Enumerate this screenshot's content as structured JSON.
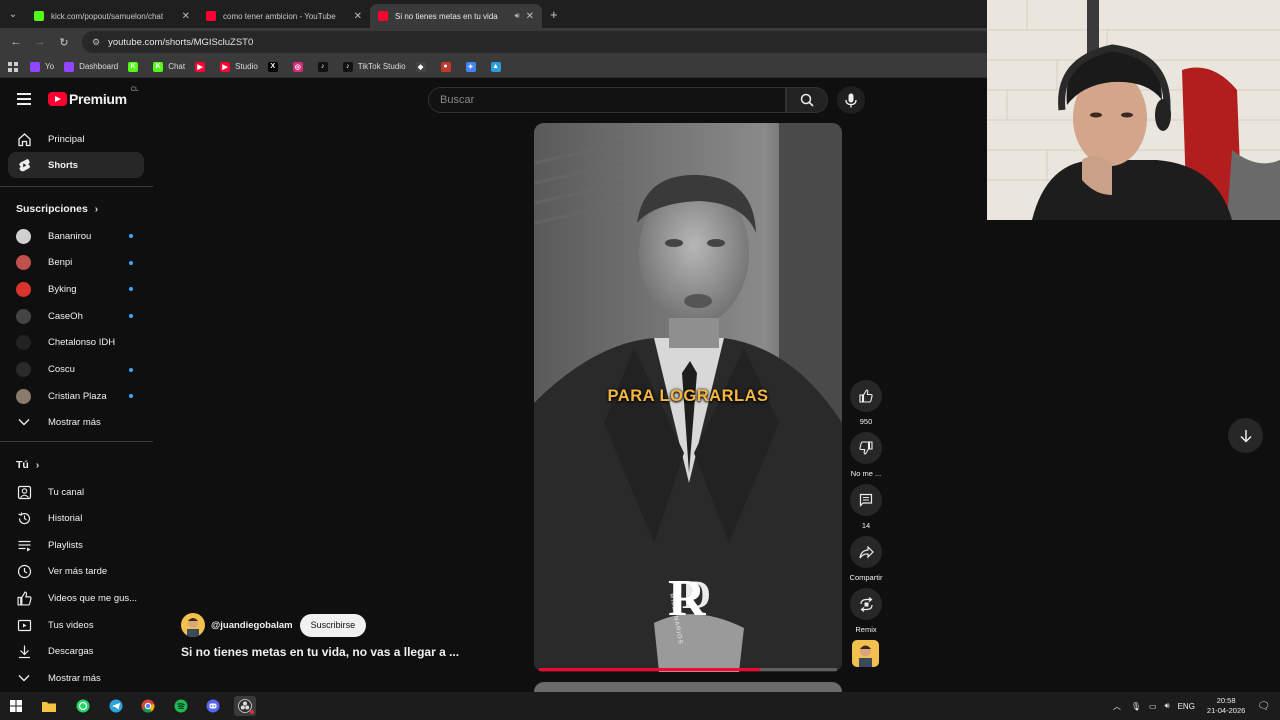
{
  "browser": {
    "tabs": [
      {
        "title": "kick.com/popout/samuelon/chat",
        "favicon_color": "#53fc18",
        "active": false
      },
      {
        "title": "como tener ambicion - YouTube",
        "favicon_color": "#ff0033",
        "active": false
      },
      {
        "title": "Si no tienes metas en tu vida",
        "favicon_color": "#ff0033",
        "active": true
      }
    ],
    "address": "youtube.com/shorts/MGIScluZST0",
    "bookmarks": [
      {
        "label": "Yo",
        "icon": "twitch-icon",
        "color": "#9146ff",
        "glyph": ""
      },
      {
        "label": "Dashboard",
        "icon": "twitch-icon",
        "color": "#9146ff",
        "glyph": ""
      },
      {
        "label": "",
        "icon": "kick-icon",
        "color": "#53fc18",
        "glyph": "K"
      },
      {
        "label": "Chat",
        "icon": "kick-icon",
        "color": "#53fc18",
        "glyph": "K"
      },
      {
        "label": "",
        "icon": "youtube-icon",
        "color": "#ff0033",
        "glyph": "▶"
      },
      {
        "label": "Studio",
        "icon": "youtube-studio-icon",
        "color": "#ff0033",
        "glyph": "▶"
      },
      {
        "label": "",
        "icon": "x-icon",
        "color": "#000000",
        "glyph": "X"
      },
      {
        "label": "",
        "icon": "instagram-icon",
        "color": "#d62976",
        "glyph": "◎"
      },
      {
        "label": "",
        "icon": "tiktok-icon",
        "color": "#111111",
        "glyph": "♪"
      },
      {
        "label": "TikTok Studio",
        "icon": "tiktok-icon",
        "color": "#111111",
        "glyph": "♪"
      },
      {
        "label": "",
        "icon": "bookmark-icon",
        "color": "#444444",
        "glyph": "◆"
      },
      {
        "label": "",
        "icon": "bookmark-icon",
        "color": "#c0392b",
        "glyph": "●"
      },
      {
        "label": "",
        "icon": "gemini-icon",
        "color": "#4285f4",
        "glyph": "✦"
      },
      {
        "label": "",
        "icon": "bookmark-icon",
        "color": "#2d9cdb",
        "glyph": "▲"
      }
    ]
  },
  "youtube": {
    "logo_text": "Premium",
    "country": "CL",
    "search_placeholder": "Buscar"
  },
  "sidebar": {
    "main": [
      {
        "label": "Principal",
        "icon": "home-icon"
      },
      {
        "label": "Shorts",
        "icon": "shorts-icon"
      }
    ],
    "subs_title": "Suscripciones",
    "subscriptions": [
      {
        "label": "Bananirou",
        "color": "#d0d0d0"
      },
      {
        "label": "Benpi",
        "color": "#c0504d"
      },
      {
        "label": "Byking",
        "color": "#d9342b"
      },
      {
        "label": "CaseOh",
        "color": "#444444"
      },
      {
        "label": "Chetalonso IDH",
        "color": "#222222"
      },
      {
        "label": "Coscu",
        "color": "#2a2a2a"
      },
      {
        "label": "Cristian Plaza",
        "color": "#8c7a6a"
      }
    ],
    "show_more_subs": "Mostrar más",
    "you_title": "Tú",
    "you_items": [
      {
        "label": "Tu canal",
        "icon": "account-icon"
      },
      {
        "label": "Historial",
        "icon": "history-icon"
      },
      {
        "label": "Playlists",
        "icon": "playlist-icon"
      },
      {
        "label": "Ver más tarde",
        "icon": "clock-icon"
      },
      {
        "label": "Videos que me gus...",
        "icon": "thumb-up-icon"
      },
      {
        "label": "Tus videos",
        "icon": "video-icon"
      },
      {
        "label": "Descargas",
        "icon": "download-icon"
      },
      {
        "label": "Mostrar más",
        "icon": "chevron-down-icon"
      }
    ]
  },
  "short": {
    "caption": "PARA LOGRARLAS",
    "watermark": "MILLONARIOS",
    "channel": "@juandiegobalam",
    "subscribe_label": "Suscribirse",
    "title": "Si no tienes metas en tu vida, no vas a llegar a ...",
    "progress": 0.74,
    "likes": "950",
    "dislike_label": "No me ...",
    "comments": "14",
    "share_label": "Compartir",
    "remix_label": "Remix"
  },
  "taskbar": {
    "apps": [
      "windows-start-icon",
      "file-explorer-icon",
      "whatsapp-icon",
      "telegram-icon",
      "chrome-icon",
      "spotify-icon",
      "discord-icon",
      "obs-icon"
    ],
    "language": "ENG",
    "time": "20:58",
    "date": "21-04-2026"
  }
}
